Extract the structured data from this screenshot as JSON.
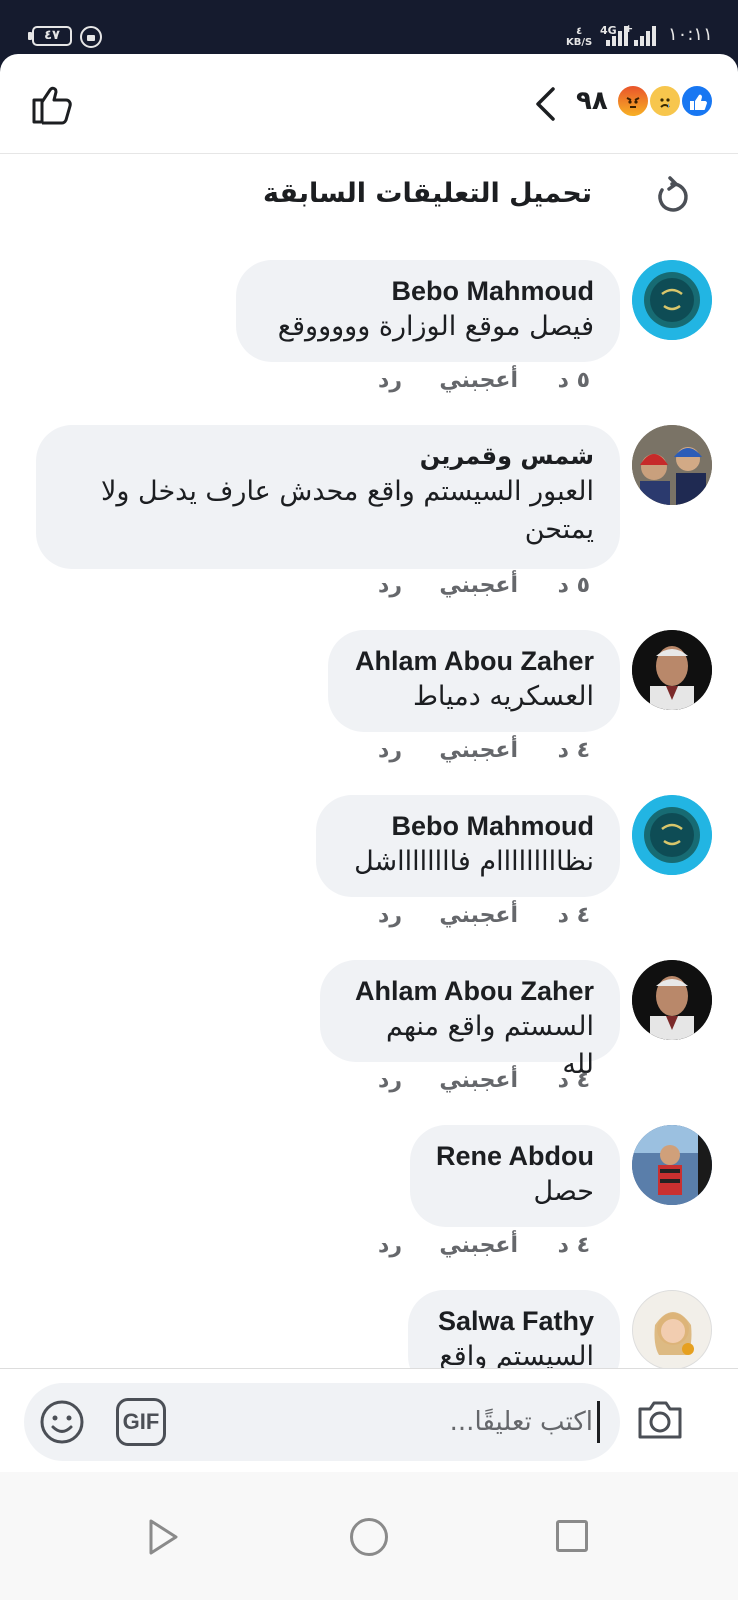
{
  "status_bar": {
    "battery": "٤٧",
    "speed_value": "٤",
    "speed_unit": "KB/S",
    "network": "4G",
    "network_plus": "+",
    "time": "١٠:١١"
  },
  "header": {
    "reaction_count": "٩٨",
    "reactions": [
      "angry-reaction-icon",
      "sad-reaction-icon",
      "like-reaction-icon"
    ]
  },
  "load_previous": {
    "label": "تحميل التعليقات السابقة"
  },
  "comments": [
    {
      "author": "Bebo Mahmoud",
      "text": [
        "فيصل موقع الوزارة وووووقع"
      ],
      "time": "٥ د",
      "like_label": "أعجبني",
      "reply_label": "رد"
    },
    {
      "author": "شمس وقمرين",
      "text": [
        "العبور السيستم واقع محدش عارف يدخل ولا",
        "يمتحن"
      ],
      "time": "٥ د",
      "like_label": "أعجبني",
      "reply_label": "رد"
    },
    {
      "author": "Ahlam Abou Zaher",
      "text": [
        "العسكريه دمياط"
      ],
      "time": "٤ د",
      "like_label": "أعجبني",
      "reply_label": "رد"
    },
    {
      "author": "Bebo Mahmoud",
      "text": [
        "نظااااااااام فااااااااشل"
      ],
      "time": "٤ د",
      "like_label": "أعجبني",
      "reply_label": "رد"
    },
    {
      "author": "Ahlam Abou Zaher",
      "text": [
        "السستم واقع منهم لله"
      ],
      "time": "٤ د",
      "like_label": "أعجبني",
      "reply_label": "رد"
    },
    {
      "author": "Rene Abdou",
      "text": [
        "حصل"
      ],
      "time": "٤ د",
      "like_label": "أعجبني",
      "reply_label": "رد"
    },
    {
      "author": "Salwa Fathy",
      "text": [
        "السيستم واقع"
      ],
      "time": "",
      "like_label": "",
      "reply_label": ""
    }
  ],
  "composer": {
    "placeholder": "اكتب تعليقًا...",
    "gif_label": "GIF"
  },
  "colors": {
    "status_bar_bg": "#151b2e",
    "bubble_bg": "#f0f2f5",
    "text_primary": "#1c1e21",
    "text_secondary": "#65676b",
    "like_blue": "#1877f2"
  }
}
